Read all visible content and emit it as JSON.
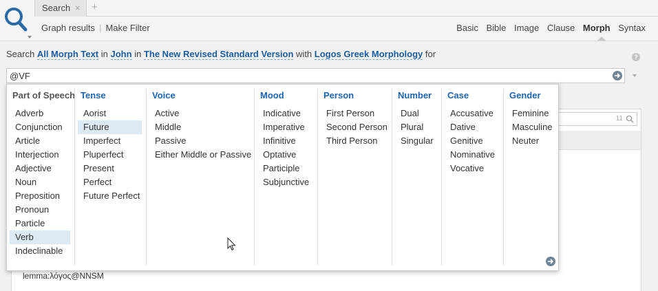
{
  "tabs": [
    {
      "label": "Search",
      "close": "×"
    }
  ],
  "tab_add": "+",
  "toolbar": {
    "graph_results": "Graph results",
    "separator": "|",
    "make_filter": "Make Filter"
  },
  "modes": [
    "Basic",
    "Bible",
    "Image",
    "Clause",
    "Morph",
    "Syntax"
  ],
  "active_mode": "Morph",
  "search_line": {
    "prefix": "Search",
    "scope": "All Morph Text",
    "in1": "in",
    "book": "John",
    "in2": "in",
    "version": "The New Revised Standard Version",
    "with": "with",
    "morphology": "Logos Greek Morphology",
    "for": "for"
  },
  "help": "?",
  "query": {
    "value": "@VF"
  },
  "result_panel": {
    "count": "11",
    "row_text": "lemma:λόγος@NNSM"
  },
  "columns": [
    {
      "header": "Part of Speech",
      "items": [
        "Adverb",
        "Conjunction",
        "Article",
        "Interjection",
        "Adjective",
        "Noun",
        "Preposition",
        "Pronoun",
        "Particle",
        "Verb",
        "Indeclinable"
      ],
      "selected": "Verb"
    },
    {
      "header": "Tense",
      "items": [
        "Aorist",
        "Future",
        "Imperfect",
        "Pluperfect",
        "Present",
        "Perfect",
        "Future Perfect"
      ],
      "selected": "Future"
    },
    {
      "header": "Voice",
      "items": [
        "Active",
        "Middle",
        "Passive",
        "Either Middle or Passive"
      ],
      "selected": ""
    },
    {
      "header": "Mood",
      "items": [
        "Indicative",
        "Imperative",
        "Infinitive",
        "Optative",
        "Participle",
        "Subjunctive"
      ],
      "selected": ""
    },
    {
      "header": "Person",
      "items": [
        "First Person",
        "Second Person",
        "Third Person"
      ],
      "selected": ""
    },
    {
      "header": "Number",
      "items": [
        "Dual",
        "Plural",
        "Singular"
      ],
      "selected": ""
    },
    {
      "header": "Case",
      "items": [
        "Accusative",
        "Dative",
        "Genitive",
        "Nominative",
        "Vocative"
      ],
      "selected": ""
    },
    {
      "header": "Gender",
      "items": [
        "Feminine",
        "Masculine",
        "Neuter"
      ],
      "selected": ""
    }
  ],
  "icons": {
    "logo": "search-magnifier-icon",
    "go": "arrow-right-circle-icon",
    "more": "arrow-right-circle-icon",
    "help": "help-icon"
  },
  "colors": {
    "link": "#1a5c9f",
    "column_header": "#1d63b0",
    "selection": "#dbeaf5",
    "go_button": "#6f8596"
  }
}
